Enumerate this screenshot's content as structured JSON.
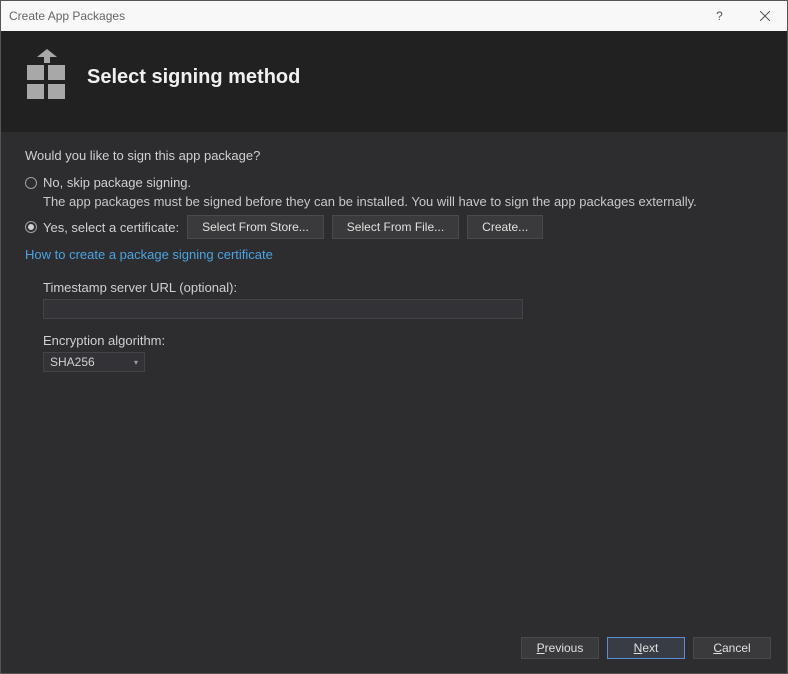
{
  "window": {
    "title": "Create App Packages"
  },
  "header": {
    "title": "Select signing method"
  },
  "content": {
    "prompt": "Would you like to sign this app package?",
    "option_no": "No, skip package signing.",
    "option_no_sub": "The app packages must be signed before they can be installed. You will have to sign the app packages externally.",
    "option_yes": "Yes, select a certificate:",
    "btn_store": "Select From Store...",
    "btn_file": "Select From File...",
    "btn_create": "Create...",
    "link": "How to create a package signing certificate",
    "timestamp_label": "Timestamp server URL (optional):",
    "timestamp_value": "",
    "encryption_label": "Encryption algorithm:",
    "encryption_value": "SHA256"
  },
  "footer": {
    "previous": "revious",
    "next": "ext",
    "cancel": "ancel"
  }
}
